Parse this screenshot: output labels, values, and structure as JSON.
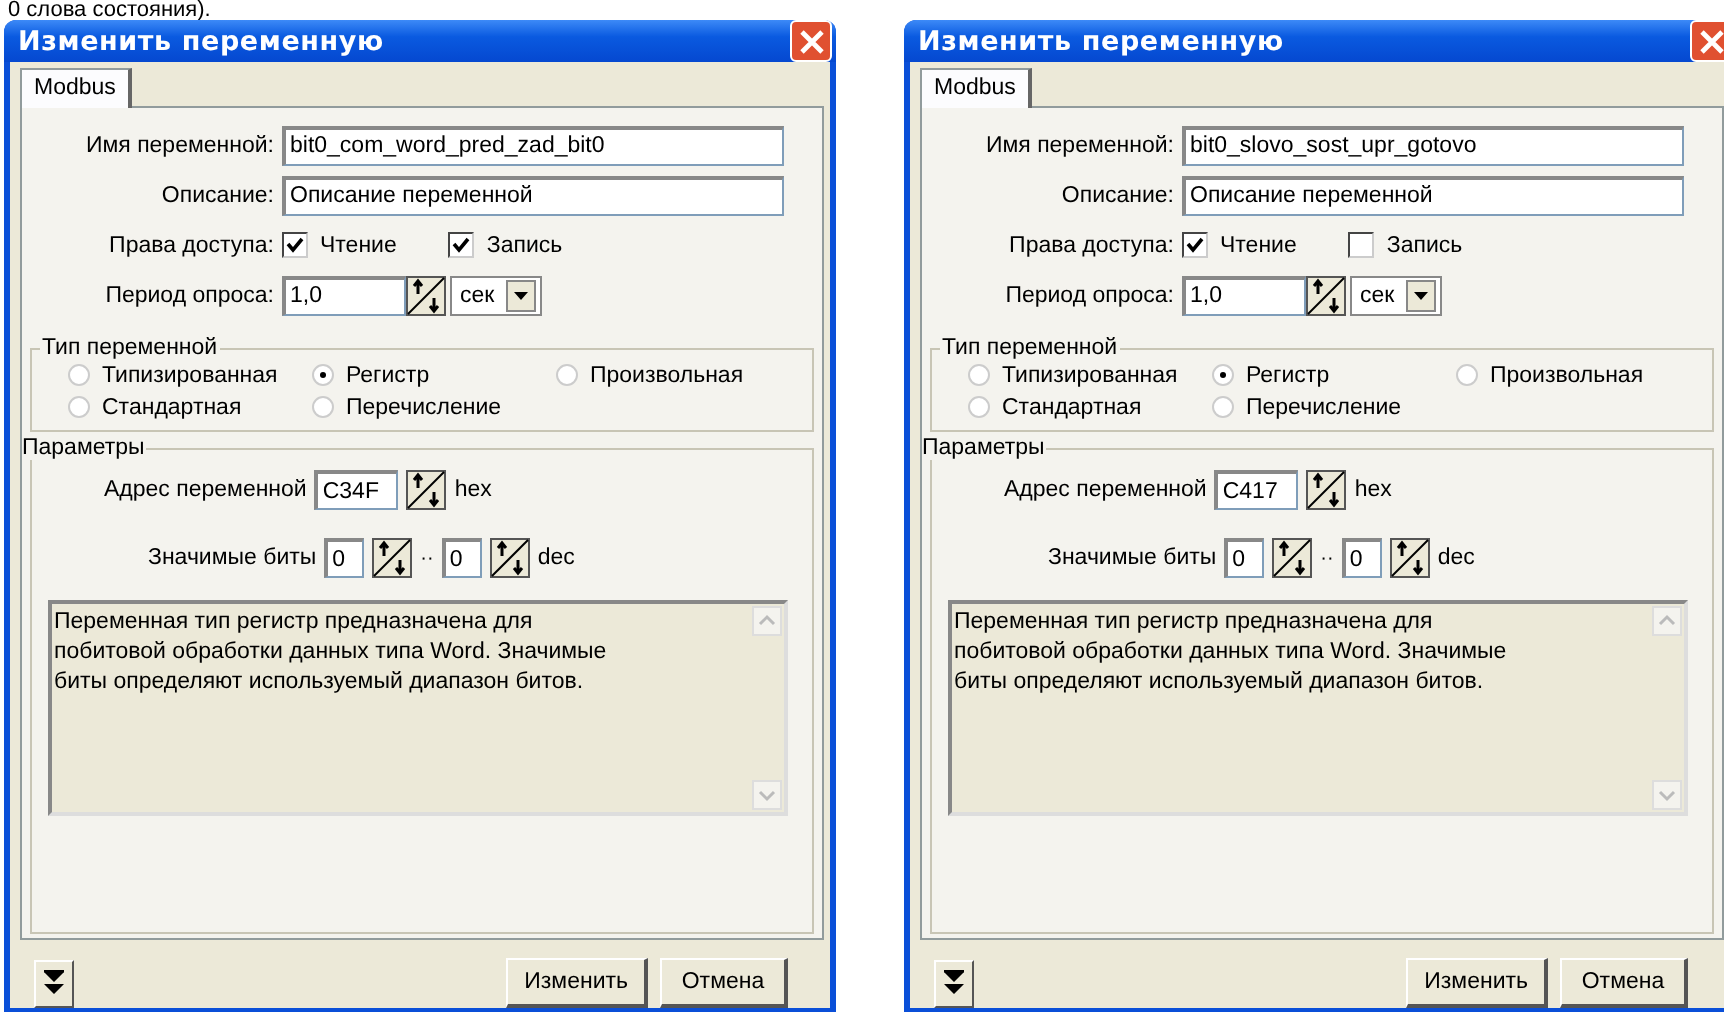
{
  "caption": "0 слова состояния).",
  "dialogs": [
    {
      "title": "Изменить переменную",
      "tabs": [
        {
          "label": "Modbus",
          "selected": true
        }
      ],
      "name_label": "Имя переменной:",
      "name_value": "bit0_com_word_pred_zad_bit0",
      "description_label": "Описание:",
      "description_value": "Описание переменной",
      "access_label": "Права доступа:",
      "access": [
        {
          "label": "Чтение",
          "checked": true
        },
        {
          "label": "Запись",
          "checked": true
        }
      ],
      "period_label": "Период опроса:",
      "period_value": "1,0",
      "period_unit": "сек",
      "type_group": {
        "title": "Тип переменной",
        "options": [
          {
            "label": "Типизированная",
            "selected": false
          },
          {
            "label": "Регистр",
            "selected": true
          },
          {
            "label": "Произвольная",
            "selected": false
          },
          {
            "label": "Стандартная",
            "selected": false
          },
          {
            "label": "Перечисление",
            "selected": false
          }
        ]
      },
      "params": {
        "title": "Параметры",
        "address_label": "Адрес переменной",
        "address_value": "C34F",
        "address_unit": "hex",
        "bits_label": "Значимые биты",
        "bits_from": "0",
        "bits_separator": "··",
        "bits_to": "0",
        "bits_unit": "dec",
        "info_text": " Переменная тип регистр предназначена для\nпобитовой обработки данных типа Word. Значимые\nбиты определяют используемый диапазон битов."
      },
      "buttons": [
        "Изменить",
        "Отмена"
      ]
    },
    {
      "title": "Изменить переменную",
      "tabs": [
        {
          "label": "Modbus",
          "selected": true
        }
      ],
      "name_label": "Имя переменной:",
      "name_value": "bit0_slovo_sost_upr_gotovo",
      "description_label": "Описание:",
      "description_value": "Описание переменной",
      "access_label": "Права доступа:",
      "access": [
        {
          "label": "Чтение",
          "checked": true
        },
        {
          "label": "Запись",
          "checked": false
        }
      ],
      "period_label": "Период опроса:",
      "period_value": "1,0",
      "period_unit": "сек",
      "type_group": {
        "title": "Тип переменной",
        "options": [
          {
            "label": "Типизированная",
            "selected": false
          },
          {
            "label": "Регистр",
            "selected": true
          },
          {
            "label": "Произвольная",
            "selected": false
          },
          {
            "label": "Стандартная",
            "selected": false
          },
          {
            "label": "Перечисление",
            "selected": false
          }
        ]
      },
      "params": {
        "title": "Параметры",
        "address_label": "Адрес переменной",
        "address_value": "C417",
        "address_unit": "hex",
        "bits_label": "Значимые биты",
        "bits_from": "0",
        "bits_separator": "··",
        "bits_to": "0",
        "bits_unit": "dec",
        "info_text": " Переменная тип регистр предназначена для\nпобитовой обработки данных типа Word. Значимые\nбиты определяют используемый диапазон битов."
      },
      "buttons": [
        "Изменить",
        "Отмена"
      ]
    }
  ]
}
